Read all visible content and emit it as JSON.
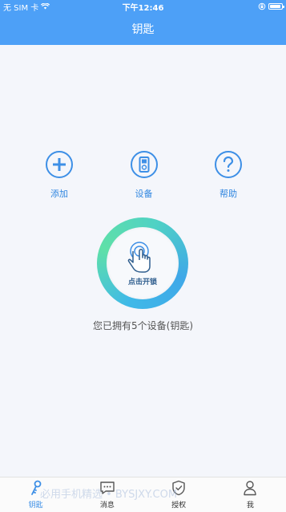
{
  "status_bar": {
    "carrier": "无 SIM 卡",
    "time": "下午12:46",
    "battery_level": 0.95
  },
  "nav": {
    "title": "钥匙"
  },
  "actions": [
    {
      "label": "添加",
      "icon": "plus-icon"
    },
    {
      "label": "设备",
      "icon": "device-icon"
    },
    {
      "label": "帮助",
      "icon": "help-icon"
    }
  ],
  "unlock": {
    "label": "点击开锁"
  },
  "device_count_text": "您已拥有5个设备(钥匙)",
  "tabs": [
    {
      "label": "钥匙",
      "icon": "key-icon",
      "active": true
    },
    {
      "label": "消息",
      "icon": "message-icon",
      "active": false
    },
    {
      "label": "授权",
      "icon": "shield-icon",
      "active": false
    },
    {
      "label": "我",
      "icon": "person-icon",
      "active": false
    }
  ],
  "watermark": "必用手机精选 • BYSJXY.COM",
  "colors": {
    "primary": "#4da0f7",
    "accent": "#3d8fe6",
    "ring_start": "#3fb9e8",
    "ring_end": "#5fe0a8"
  }
}
